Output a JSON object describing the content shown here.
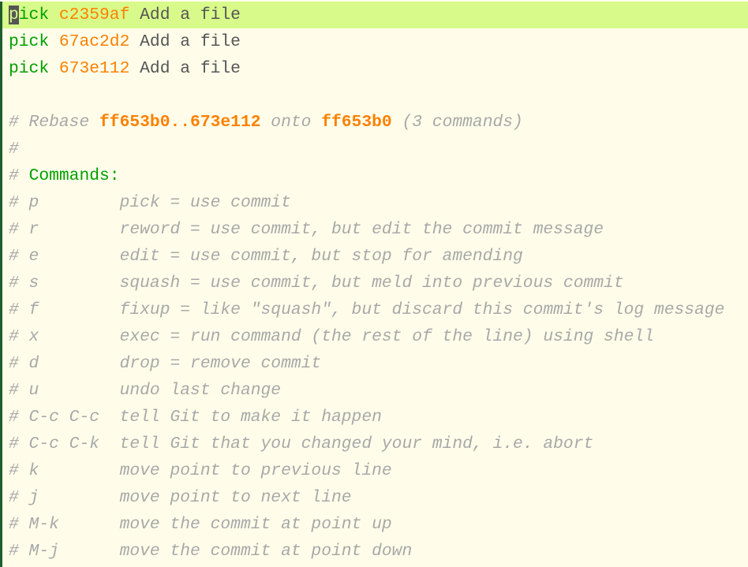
{
  "commits": [
    {
      "action": "pick",
      "hash": "c2359af",
      "message": "Add a file",
      "current": true
    },
    {
      "action": "pick",
      "hash": "67ac2d2",
      "message": "Add a file"
    },
    {
      "action": "pick",
      "hash": "673e112",
      "message": "Add a file"
    }
  ],
  "header": {
    "prefix": "# Rebase ",
    "range": "ff653b0..673e112",
    "onto_word": " onto ",
    "onto": "ff653b0",
    "suffix": " (3 commands)"
  },
  "blank_comment": "#",
  "commands_heading": {
    "prefix": "# ",
    "label": "Commands:"
  },
  "help": [
    {
      "key": "# p        ",
      "desc": "pick = use commit"
    },
    {
      "key": "# r        ",
      "desc": "reword = use commit, but edit the commit message"
    },
    {
      "key": "# e        ",
      "desc": "edit = use commit, but stop for amending"
    },
    {
      "key": "# s        ",
      "desc": "squash = use commit, but meld into previous commit"
    },
    {
      "key": "# f        ",
      "desc": "fixup = like \"squash\", but discard this commit's log message"
    },
    {
      "key": "# x        ",
      "desc": "exec = run command (the rest of the line) using shell"
    },
    {
      "key": "# d        ",
      "desc": "drop = remove commit"
    },
    {
      "key": "# u        ",
      "desc": "undo last change"
    },
    {
      "key": "# C-c C-c  ",
      "desc": "tell Git to make it happen"
    },
    {
      "key": "# C-c C-k  ",
      "desc": "tell Git that you changed your mind, i.e. abort"
    },
    {
      "key": "# k        ",
      "desc": "move point to previous line"
    },
    {
      "key": "# j        ",
      "desc": "move point to next line"
    },
    {
      "key": "# M-k      ",
      "desc": "move the commit at point up"
    },
    {
      "key": "# M-j      ",
      "desc": "move the commit at point down"
    }
  ]
}
